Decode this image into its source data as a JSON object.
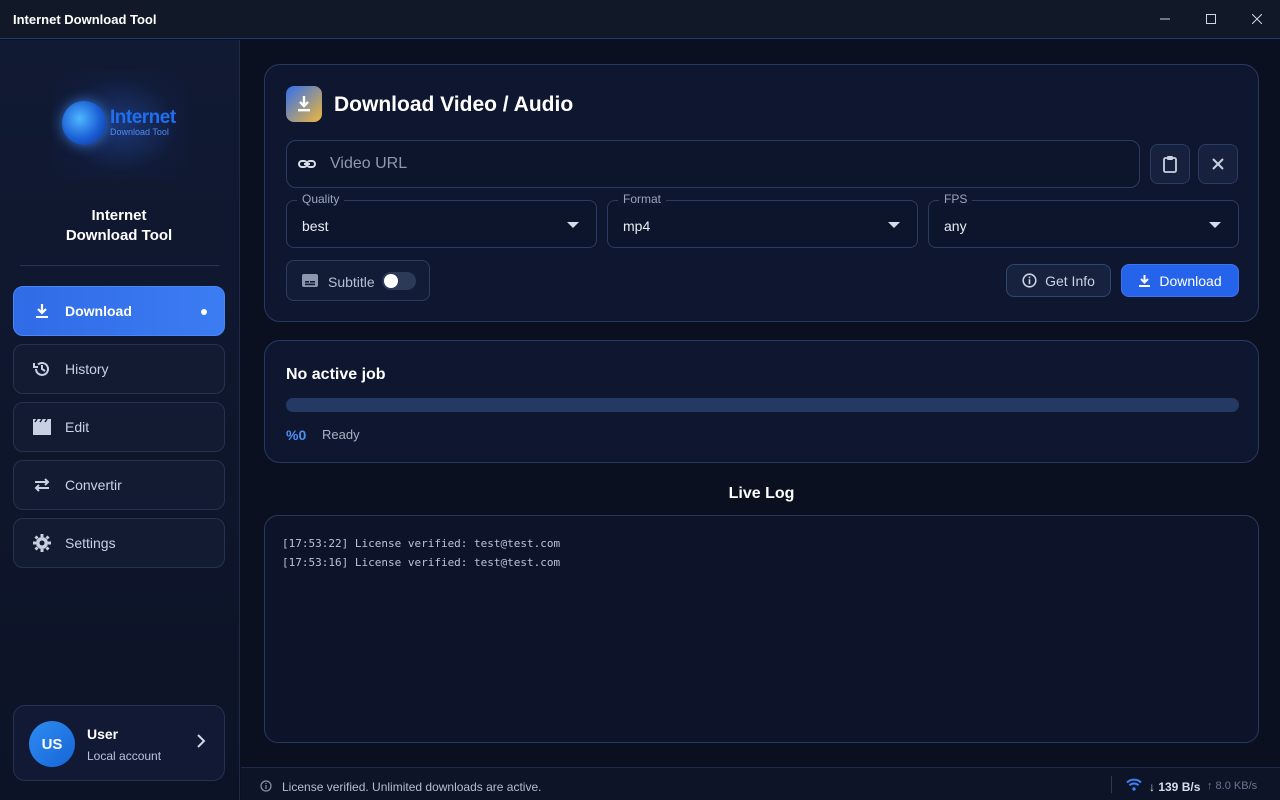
{
  "window": {
    "title": "Internet Download Tool",
    "controls": [
      "minimize",
      "maximize",
      "close"
    ]
  },
  "sidebar": {
    "logo": {
      "word1": "Internet",
      "word2": "Download Tool"
    },
    "brand_line1": "Internet",
    "brand_line2": "Download Tool",
    "items": [
      {
        "label": "Download",
        "icon": "download-icon",
        "active": true
      },
      {
        "label": "History",
        "icon": "history-icon",
        "active": false
      },
      {
        "label": "Edit",
        "icon": "film-icon",
        "active": false
      },
      {
        "label": "Convertir",
        "icon": "swap-icon",
        "active": false
      },
      {
        "label": "Settings",
        "icon": "gear-icon",
        "active": false
      }
    ],
    "user": {
      "initials": "US",
      "name": "User",
      "subtitle": "Local account"
    }
  },
  "download_card": {
    "title": "Download Video / Audio",
    "url_placeholder": "Video URL",
    "url_value": "",
    "quality": {
      "label": "Quality",
      "value": "best"
    },
    "format": {
      "label": "Format",
      "value": "mp4"
    },
    "fps": {
      "label": "FPS",
      "value": "any"
    },
    "subtitle": {
      "label": "Subtitle",
      "enabled": false
    },
    "get_info_label": "Get Info",
    "download_label": "Download"
  },
  "job": {
    "title": "No active job",
    "progress_text": "%0",
    "progress": 0,
    "status": "Ready"
  },
  "log": {
    "heading": "Live Log",
    "lines": [
      "[17:53:22] License verified: test@test.com",
      "[17:53:16] License verified: test@test.com"
    ]
  },
  "statusbar": {
    "message": "License verified. Unlimited downloads are active.",
    "download_speed": "↓ 139 B/s",
    "upload_speed": "↑ 8.0 KB/s"
  },
  "colors": {
    "accent": "#2563eb",
    "background": "#0b1020",
    "card": "#0f1730"
  }
}
